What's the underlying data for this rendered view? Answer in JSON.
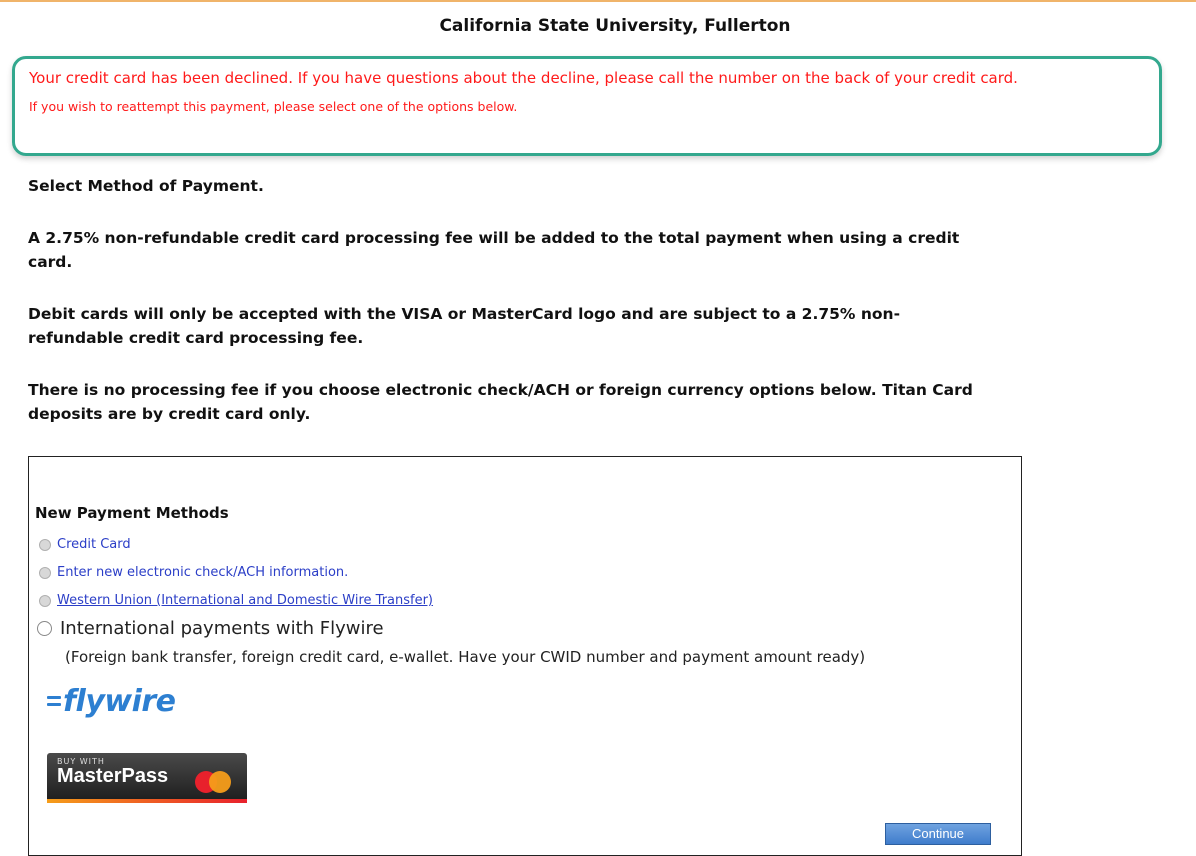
{
  "header": {
    "title": "California State University, Fullerton"
  },
  "alert": {
    "line1": "Your credit card has been declined. If you have questions about the decline, please call the number on the back of your credit card.",
    "line2": "If you wish to reattempt this payment, please select one of the options below.",
    "border_color": "#33a88e",
    "text_color": "#ff1a1a"
  },
  "info": {
    "select_method": "Select Method of Payment.",
    "fee_notice": "A 2.75% non-refundable credit card processing fee will be added to the total payment when using a credit card.",
    "debit_notice": "Debit cards will only be accepted with the VISA or MasterCard logo and are subject to a 2.75% non-refundable credit card processing fee.",
    "no_fee_notice": "There is no processing fee if you choose electronic check/ACH or foreign currency options below. Titan Card deposits are by credit card only."
  },
  "payment": {
    "heading": "New Payment Methods",
    "options": [
      {
        "label": "Credit Card"
      },
      {
        "label": "Enter new electronic check/ACH information."
      },
      {
        "label": "Western Union (International and Domestic Wire Transfer)"
      },
      {
        "label": "International payments with Flywire"
      }
    ],
    "flywire_sub": "(Foreign bank transfer, foreign credit card, e-wallet. Have your CWID number and payment amount ready)",
    "flywire_logo_text": "flywire",
    "masterpass_small": "BUY WITH",
    "masterpass_text": "MasterPass",
    "continue_label": "Continue"
  }
}
